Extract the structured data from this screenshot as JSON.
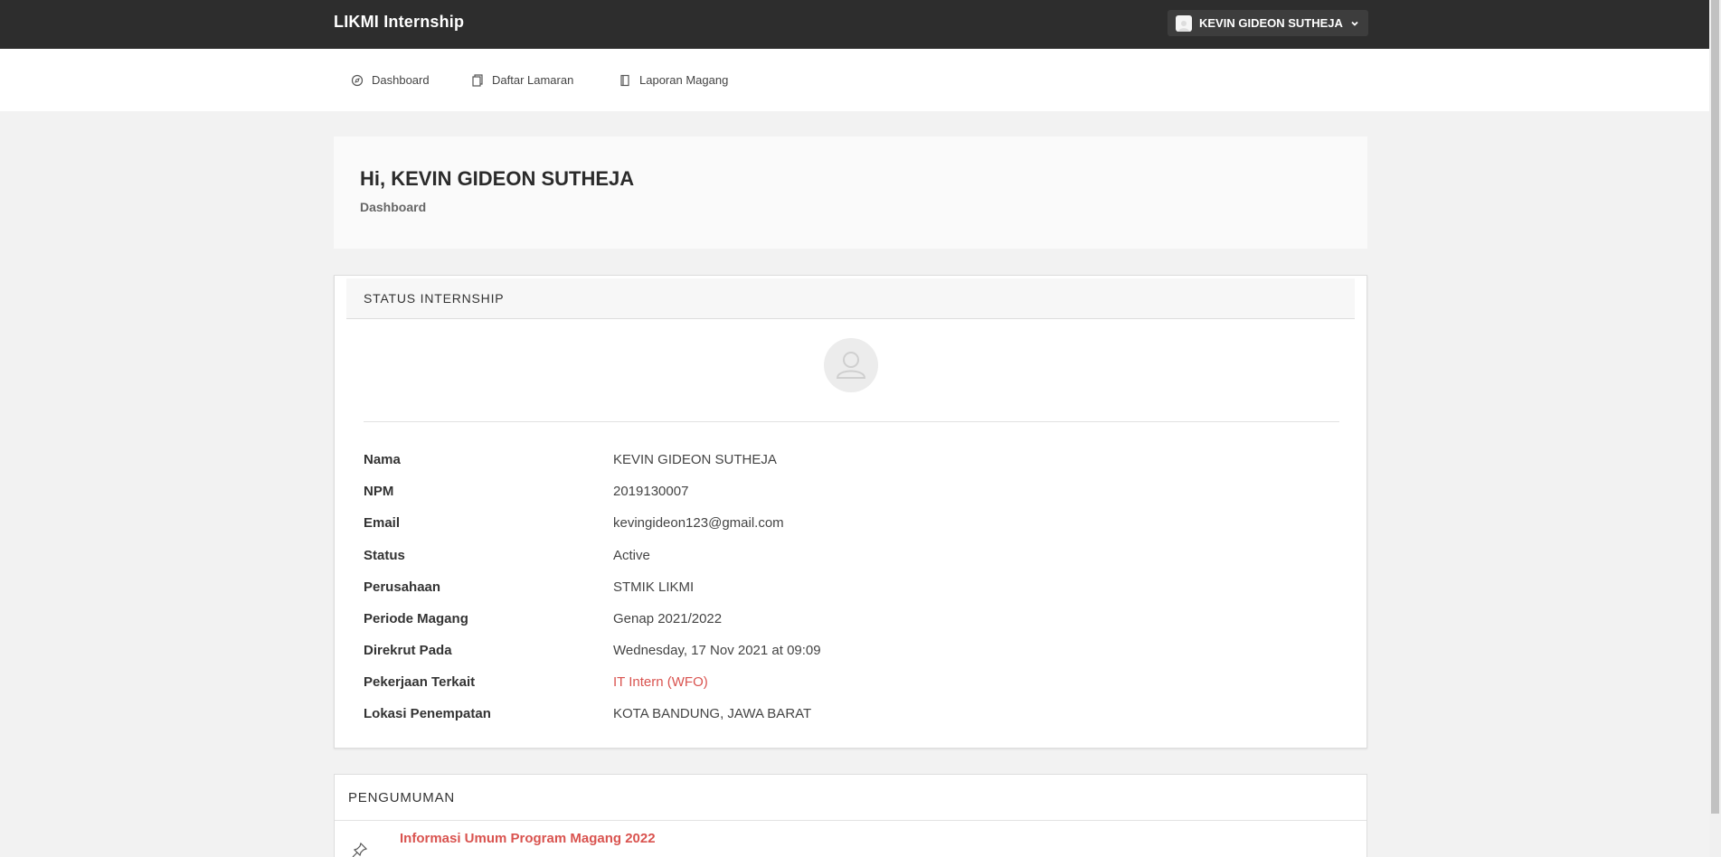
{
  "topbar": {
    "brand": "LIKMI Internship",
    "user_name": "KEVIN GIDEON SUTHEJA"
  },
  "nav": {
    "items": [
      {
        "label": "Dashboard",
        "icon": "compass-icon"
      },
      {
        "label": "Daftar Lamaran",
        "icon": "documents-icon"
      },
      {
        "label": "Laporan Magang",
        "icon": "book-icon"
      }
    ]
  },
  "hero": {
    "greeting": "Hi, KEVIN GIDEON SUTHEJA",
    "breadcrumb": "Dashboard"
  },
  "status_card": {
    "title": "STATUS INTERNSHIP",
    "fields": [
      {
        "label": "Nama",
        "value": "KEVIN GIDEON SUTHEJA"
      },
      {
        "label": "NPM",
        "value": "2019130007"
      },
      {
        "label": "Email",
        "value": "kevingideon123@gmail.com"
      },
      {
        "label": "Status",
        "value": "Active"
      },
      {
        "label": "Perusahaan",
        "value": "STMIK LIKMI"
      },
      {
        "label": "Periode Magang",
        "value": "Genap 2021/2022"
      },
      {
        "label": "Direkrut Pada",
        "value": "Wednesday, 17 Nov 2021 at 09:09"
      },
      {
        "label": "Pekerjaan Terkait",
        "value": "IT Intern (WFO)"
      },
      {
        "label": "Lokasi Penempatan",
        "value": "KOTA BANDUNG, JAWA BARAT"
      }
    ]
  },
  "announcements": {
    "title": "PENGUMUMAN",
    "items": [
      {
        "title": "Informasi Umum Program Magang 2022",
        "icon": "pin-icon"
      }
    ]
  },
  "colors": {
    "topbar": "#2d2d2d",
    "accent_link": "#d9534f",
    "background": "#f2f2f2"
  }
}
